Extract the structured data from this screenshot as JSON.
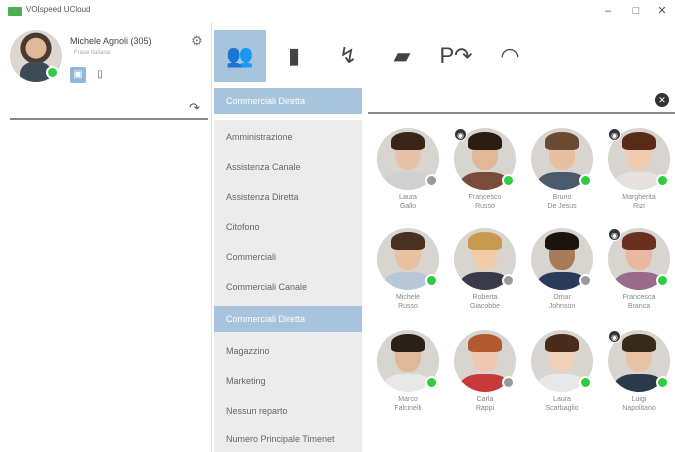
{
  "window": {
    "title": "VOIspeed UCloud",
    "minimize": "–",
    "maximize": "□",
    "close": "✕"
  },
  "profile": {
    "name": "Michele Agnoli (305)",
    "subtitle": "Frase italiana",
    "status": "online"
  },
  "toolbar": {
    "buttons": [
      {
        "name": "contacts",
        "glyph": "👥",
        "active": true
      },
      {
        "name": "phonebook",
        "glyph": "▮",
        "active": false
      },
      {
        "name": "call-history",
        "glyph": "↯",
        "active": false
      },
      {
        "name": "chat",
        "glyph": "▰",
        "active": false
      },
      {
        "name": "parking",
        "glyph": "P↷",
        "active": false
      },
      {
        "name": "dashboard",
        "glyph": "◠",
        "active": false
      }
    ]
  },
  "departments": {
    "header": "Commerciali Diretta",
    "items": [
      "Amministrazione",
      "Assistenza Canale",
      "Assistenza Diretta",
      "Citofono",
      "Commerciali",
      "Commerciali Canale",
      "Commerciali Diretta",
      "Magazzino",
      "Marketing",
      "Nessun reparto",
      "Numero Principale Timenet"
    ],
    "selected_index": 6
  },
  "contacts": [
    {
      "first": "Laura",
      "last": "Gallo",
      "status": "offline",
      "badge": false,
      "skin": "#e8c2a8",
      "hair": "#3a2418",
      "body": "#d0d0d0"
    },
    {
      "first": "Francesco",
      "last": "Russo",
      "status": "online",
      "badge": true,
      "skin": "#e0b896",
      "hair": "#2b1d14",
      "body": "#7a4a3a"
    },
    {
      "first": "Bruno",
      "last": "De Jesus",
      "status": "online",
      "badge": false,
      "skin": "#e6c0a0",
      "hair": "#6a4a30",
      "body": "#4a5a6a"
    },
    {
      "first": "Margherita",
      "last": "Rizi",
      "status": "online",
      "badge": true,
      "skin": "#f0cbb0",
      "hair": "#5a2a18",
      "body": "#e8e0e0"
    },
    {
      "first": "Michele",
      "last": "Russo",
      "status": "online",
      "badge": false,
      "skin": "#e8c2a0",
      "hair": "#4a3020",
      "body": "#b8c8d8"
    },
    {
      "first": "Roberta",
      "last": "Giacobbe",
      "status": "offline",
      "badge": false,
      "skin": "#f0cca8",
      "hair": "#c89a50",
      "body": "#3a3a4a"
    },
    {
      "first": "Omar",
      "last": "Johnson",
      "status": "offline",
      "badge": false,
      "skin": "#a87a58",
      "hair": "#1a1410",
      "body": "#2a3a5a"
    },
    {
      "first": "Francesca",
      "last": "Branca",
      "status": "online",
      "badge": true,
      "skin": "#e8b8a0",
      "hair": "#6a3020",
      "body": "#9a6a8a"
    },
    {
      "first": "Marco",
      "last": "Falcinelli",
      "status": "online",
      "badge": false,
      "skin": "#e0b898",
      "hair": "#2a2018",
      "body": "#e8e8e8"
    },
    {
      "first": "Carla",
      "last": "Rappi",
      "status": "offline",
      "badge": false,
      "skin": "#f0c8b0",
      "hair": "#b05a30",
      "body": "#c83a3a"
    },
    {
      "first": "Laura",
      "last": "Scarbaglio",
      "status": "online",
      "badge": false,
      "skin": "#f0d0b8",
      "hair": "#4a2a18",
      "body": "#e8e8e8"
    },
    {
      "first": "Luigi",
      "last": "Napolitano",
      "status": "online",
      "badge": true,
      "skin": "#e8c4a4",
      "hair": "#3a2818",
      "body": "#2a3a4a"
    }
  ]
}
